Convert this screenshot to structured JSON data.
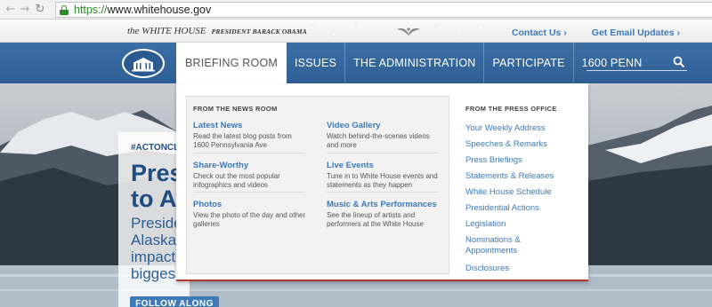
{
  "browser": {
    "url_scheme": "https://",
    "url_rest": "www.whitehouse.gov"
  },
  "topbar": {
    "brand": "the WHITE HOUSE",
    "president": "PRESIDENT BARACK OBAMA",
    "contact": "Contact Us",
    "updates": "Get Email Updates"
  },
  "nav": {
    "items": [
      {
        "label": "BRIEFING ROOM",
        "active": true
      },
      {
        "label": "ISSUES",
        "active": false
      },
      {
        "label": "THE ADMINISTRATION",
        "active": false
      },
      {
        "label": "PARTICIPATE",
        "active": false
      },
      {
        "label": "1600 PENN",
        "active": false
      }
    ],
    "search_placeholder": ""
  },
  "dropdown": {
    "news_heading": "FROM THE NEWS ROOM",
    "press_heading": "FROM THE PRESS OFFICE",
    "news_items": [
      {
        "title": "Latest News",
        "desc": "Read the latest blog posts from 1600 Pennsylvania Ave"
      },
      {
        "title": "Video Gallery",
        "desc": "Watch behind-the-scenes videos and more"
      },
      {
        "title": "Share-Worthy",
        "desc": "Check out the most popular infographics and videos"
      },
      {
        "title": "Live Events",
        "desc": "Tune in to White House events and statements as they happen"
      },
      {
        "title": "Photos",
        "desc": "View the photo of the day and other galleries"
      },
      {
        "title": "Music & Arts Performances",
        "desc": "See the lineup of artists and performers at the White House"
      }
    ],
    "press_links": [
      "Your Weekly Address",
      "Speeches & Remarks",
      "Press Briefings",
      "Statements & Releases",
      "White House Schedule",
      "Presidential Actions",
      "Legislation",
      "Nominations & Appointments",
      "Disclosures"
    ]
  },
  "hero": {
    "hashtag": "#ACTONCLI",
    "title_line1": "Pres",
    "title_line2": "to A",
    "body_line1": "Preside",
    "body_line2": "Alaska",
    "body_line3": "impact",
    "body_line4": "bigges",
    "button": "FOLLOW ALONG"
  },
  "colors": {
    "nav_blue": "#2f5f94",
    "link_blue": "#3e79b8",
    "accent_red": "#b03a2e"
  }
}
